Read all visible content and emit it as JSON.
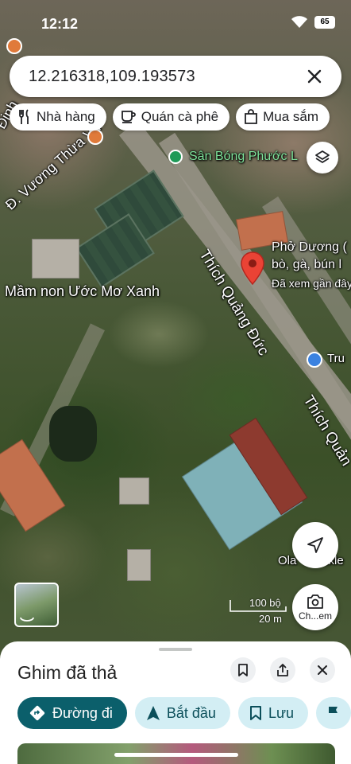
{
  "status_bar": {
    "time": "12:12",
    "battery": "65"
  },
  "search": {
    "query": "12.216318,109.193573",
    "clear_icon": "close-icon"
  },
  "chips": [
    {
      "label": "Nhà hàng",
      "icon": "restaurant-icon"
    },
    {
      "label": "Quán cà phê",
      "icon": "coffee-icon"
    },
    {
      "label": "Mua sắm",
      "icon": "shopping-bag-icon"
    }
  ],
  "map": {
    "labels": {
      "road_vuong_thua_vu": "Đ. Vương Thừa Vũ",
      "road_thich_quang_duc": "Thích Quảng Đức",
      "road_thich_quang_duc_2": "Thích Quản",
      "road_dinh": "Đinh",
      "school": "Mầm non Ước Mơ Xanh",
      "stadium": "Sân Bóng Phước L",
      "restaurant_line1": "Phở Dương (",
      "restaurant_line2": "bò, gà, bún l",
      "restaurant_line3": "Đã xem gần đây",
      "poi_tru": "Tru",
      "poi_ola": "Ola",
      "poi_ola_suffix": "ckle"
    },
    "scale": {
      "imperial": "100 bộ",
      "metric": "20 m"
    },
    "lens_label": "Ch...em"
  },
  "sheet": {
    "title": "Ghim đã thả",
    "actions": [
      {
        "label": "Đường đi",
        "icon": "directions-icon",
        "style": "primary"
      },
      {
        "label": "Bắt đầu",
        "icon": "navigation-arrow-icon",
        "style": "tonal"
      },
      {
        "label": "Lưu",
        "icon": "bookmark-icon",
        "style": "tonal"
      }
    ]
  },
  "colors": {
    "primary": "#0b5f6b",
    "tonal": "#d3eef4",
    "pin_red": "#ea4335"
  }
}
